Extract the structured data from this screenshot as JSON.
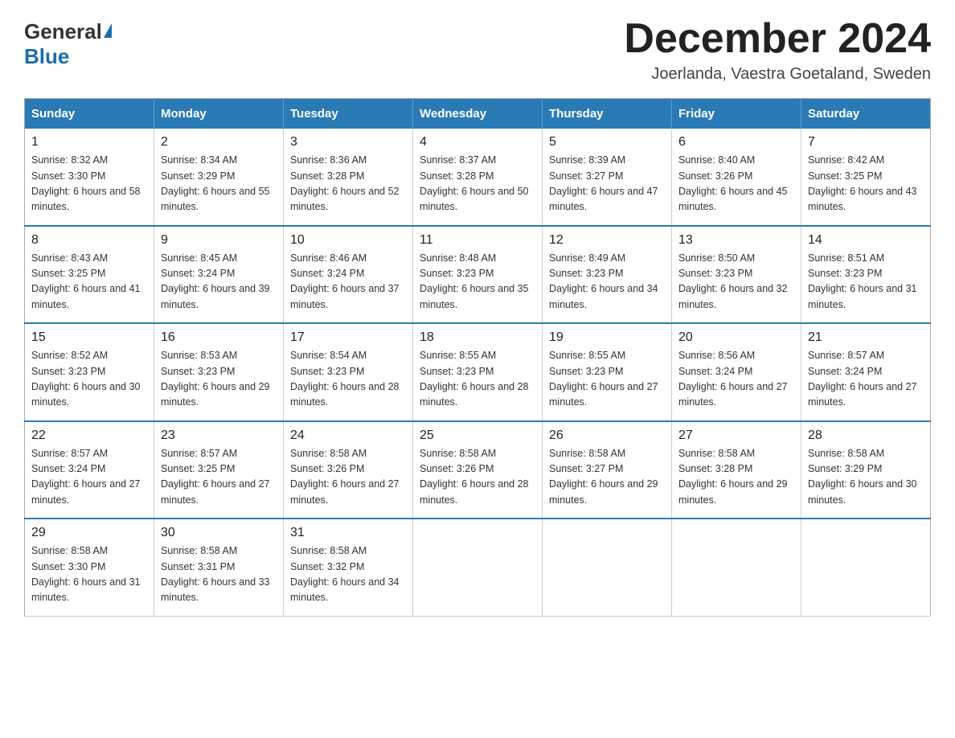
{
  "logo": {
    "general": "General",
    "blue": "Blue",
    "underline": "Blue"
  },
  "header": {
    "month_year": "December 2024",
    "location": "Joerlanda, Vaestra Goetaland, Sweden"
  },
  "days_of_week": [
    "Sunday",
    "Monday",
    "Tuesday",
    "Wednesday",
    "Thursday",
    "Friday",
    "Saturday"
  ],
  "weeks": [
    [
      {
        "day": "1",
        "sunrise": "8:32 AM",
        "sunset": "3:30 PM",
        "daylight": "6 hours and 58 minutes."
      },
      {
        "day": "2",
        "sunrise": "8:34 AM",
        "sunset": "3:29 PM",
        "daylight": "6 hours and 55 minutes."
      },
      {
        "day": "3",
        "sunrise": "8:36 AM",
        "sunset": "3:28 PM",
        "daylight": "6 hours and 52 minutes."
      },
      {
        "day": "4",
        "sunrise": "8:37 AM",
        "sunset": "3:28 PM",
        "daylight": "6 hours and 50 minutes."
      },
      {
        "day": "5",
        "sunrise": "8:39 AM",
        "sunset": "3:27 PM",
        "daylight": "6 hours and 47 minutes."
      },
      {
        "day": "6",
        "sunrise": "8:40 AM",
        "sunset": "3:26 PM",
        "daylight": "6 hours and 45 minutes."
      },
      {
        "day": "7",
        "sunrise": "8:42 AM",
        "sunset": "3:25 PM",
        "daylight": "6 hours and 43 minutes."
      }
    ],
    [
      {
        "day": "8",
        "sunrise": "8:43 AM",
        "sunset": "3:25 PM",
        "daylight": "6 hours and 41 minutes."
      },
      {
        "day": "9",
        "sunrise": "8:45 AM",
        "sunset": "3:24 PM",
        "daylight": "6 hours and 39 minutes."
      },
      {
        "day": "10",
        "sunrise": "8:46 AM",
        "sunset": "3:24 PM",
        "daylight": "6 hours and 37 minutes."
      },
      {
        "day": "11",
        "sunrise": "8:48 AM",
        "sunset": "3:23 PM",
        "daylight": "6 hours and 35 minutes."
      },
      {
        "day": "12",
        "sunrise": "8:49 AM",
        "sunset": "3:23 PM",
        "daylight": "6 hours and 34 minutes."
      },
      {
        "day": "13",
        "sunrise": "8:50 AM",
        "sunset": "3:23 PM",
        "daylight": "6 hours and 32 minutes."
      },
      {
        "day": "14",
        "sunrise": "8:51 AM",
        "sunset": "3:23 PM",
        "daylight": "6 hours and 31 minutes."
      }
    ],
    [
      {
        "day": "15",
        "sunrise": "8:52 AM",
        "sunset": "3:23 PM",
        "daylight": "6 hours and 30 minutes."
      },
      {
        "day": "16",
        "sunrise": "8:53 AM",
        "sunset": "3:23 PM",
        "daylight": "6 hours and 29 minutes."
      },
      {
        "day": "17",
        "sunrise": "8:54 AM",
        "sunset": "3:23 PM",
        "daylight": "6 hours and 28 minutes."
      },
      {
        "day": "18",
        "sunrise": "8:55 AM",
        "sunset": "3:23 PM",
        "daylight": "6 hours and 28 minutes."
      },
      {
        "day": "19",
        "sunrise": "8:55 AM",
        "sunset": "3:23 PM",
        "daylight": "6 hours and 27 minutes."
      },
      {
        "day": "20",
        "sunrise": "8:56 AM",
        "sunset": "3:24 PM",
        "daylight": "6 hours and 27 minutes."
      },
      {
        "day": "21",
        "sunrise": "8:57 AM",
        "sunset": "3:24 PM",
        "daylight": "6 hours and 27 minutes."
      }
    ],
    [
      {
        "day": "22",
        "sunrise": "8:57 AM",
        "sunset": "3:24 PM",
        "daylight": "6 hours and 27 minutes."
      },
      {
        "day": "23",
        "sunrise": "8:57 AM",
        "sunset": "3:25 PM",
        "daylight": "6 hours and 27 minutes."
      },
      {
        "day": "24",
        "sunrise": "8:58 AM",
        "sunset": "3:26 PM",
        "daylight": "6 hours and 27 minutes."
      },
      {
        "day": "25",
        "sunrise": "8:58 AM",
        "sunset": "3:26 PM",
        "daylight": "6 hours and 28 minutes."
      },
      {
        "day": "26",
        "sunrise": "8:58 AM",
        "sunset": "3:27 PM",
        "daylight": "6 hours and 29 minutes."
      },
      {
        "day": "27",
        "sunrise": "8:58 AM",
        "sunset": "3:28 PM",
        "daylight": "6 hours and 29 minutes."
      },
      {
        "day": "28",
        "sunrise": "8:58 AM",
        "sunset": "3:29 PM",
        "daylight": "6 hours and 30 minutes."
      }
    ],
    [
      {
        "day": "29",
        "sunrise": "8:58 AM",
        "sunset": "3:30 PM",
        "daylight": "6 hours and 31 minutes."
      },
      {
        "day": "30",
        "sunrise": "8:58 AM",
        "sunset": "3:31 PM",
        "daylight": "6 hours and 33 minutes."
      },
      {
        "day": "31",
        "sunrise": "8:58 AM",
        "sunset": "3:32 PM",
        "daylight": "6 hours and 34 minutes."
      },
      null,
      null,
      null,
      null
    ]
  ]
}
